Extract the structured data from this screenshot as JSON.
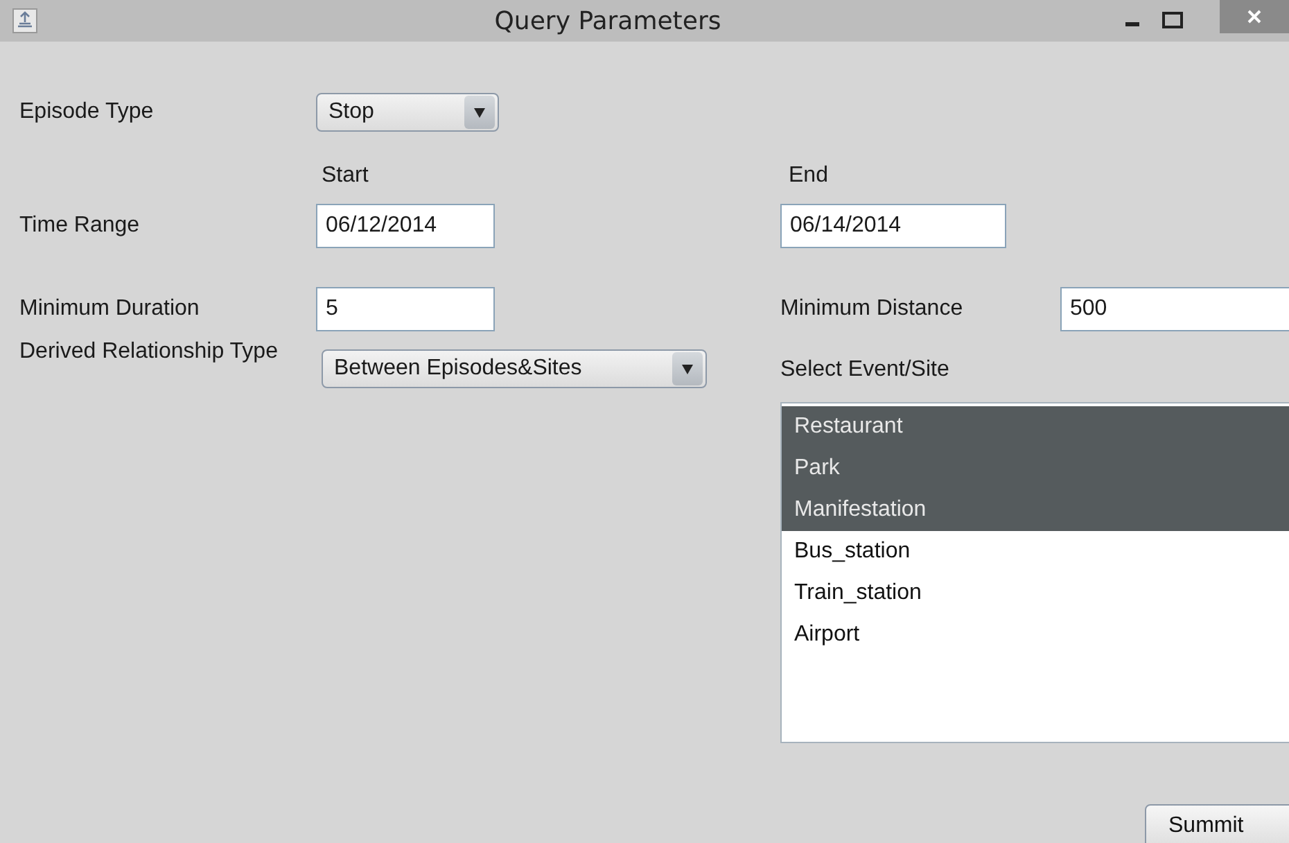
{
  "window": {
    "title": "Query Parameters"
  },
  "episode_type": {
    "label": "Episode Type",
    "value": "Stop"
  },
  "time_range": {
    "label": "Time Range",
    "start_label": "Start",
    "end_label": "End",
    "start": "06/12/2014",
    "end": "06/14/2014"
  },
  "minimum_duration": {
    "label": "Minimum Duration",
    "value": "5"
  },
  "minimum_distance": {
    "label": "Minimum Distance",
    "value": "500"
  },
  "relationship_type": {
    "label": "Derived Relationship Type",
    "value": "Between Episodes&Sites"
  },
  "event_site": {
    "label": "Select Event/Site",
    "items": [
      {
        "label": "Restaurant",
        "selected": true
      },
      {
        "label": "Park",
        "selected": true
      },
      {
        "label": "Manifestation",
        "selected": true
      },
      {
        "label": "Bus_station",
        "selected": false
      },
      {
        "label": "Train_station",
        "selected": false
      },
      {
        "label": "Airport",
        "selected": false
      }
    ]
  },
  "submit_button": "Summit"
}
